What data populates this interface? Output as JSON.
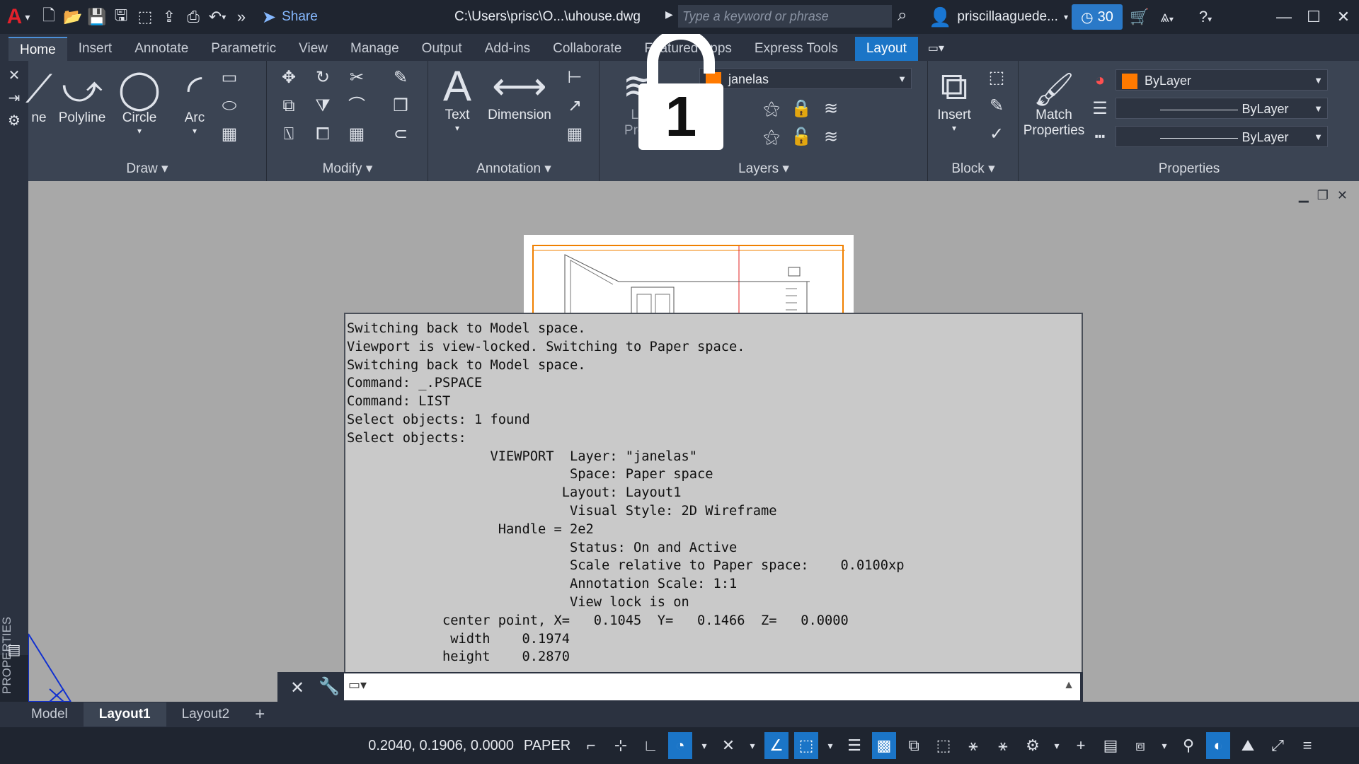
{
  "titlebar": {
    "share_label": "Share",
    "file_title": "C:\\Users\\prisc\\O...\\uhouse.dwg",
    "search_placeholder": "Type a keyword or phrase",
    "user_name": "priscillaaguede...",
    "badge_count": "30"
  },
  "ribbon_tabs": [
    "Home",
    "Insert",
    "Annotate",
    "Parametric",
    "View",
    "Manage",
    "Output",
    "Add-ins",
    "Collaborate",
    "Featured Apps",
    "Express Tools",
    "Layout"
  ],
  "ribbon": {
    "draw": {
      "title": "Draw",
      "line": "ne",
      "polyline": "Polyline",
      "circle": "Circle",
      "arc": "Arc"
    },
    "modify": {
      "title": "Modify"
    },
    "annotation": {
      "title": "Annotation",
      "text": "Text",
      "dimension": "Dimension"
    },
    "layers": {
      "title": "Layers",
      "current_layer": "janelas",
      "layer_props_1": "La",
      "layer_props_2": "Prop"
    },
    "block": {
      "title": "Block",
      "insert": "Insert"
    },
    "properties": {
      "title": "Properties",
      "match_1": "Match",
      "match_2": "Properties",
      "color": "ByLayer",
      "linetype": "ByLayer",
      "lineweight": "ByLayer"
    }
  },
  "left_palette": {
    "label": "PROPERTIES"
  },
  "lock_overlay": {
    "digit": "1"
  },
  "command_history": [
    "Switching back to Model space.",
    "Viewport is view-locked. Switching to Paper space.",
    "Switching back to Model space.",
    "Command: _.PSPACE",
    "Command: LIST",
    "Select objects: 1 found",
    "Select objects:",
    "                  VIEWPORT  Layer: \"janelas\"",
    "                            Space: Paper space",
    "                           Layout: Layout1",
    "                            Visual Style: 2D Wireframe",
    "                   Handle = 2e2",
    "                            Status: On and Active",
    "                            Scale relative to Paper space:    0.0100xp",
    "                            Annotation Scale: 1:1",
    "                            View lock is on",
    "            center point, X=   0.1045  Y=   0.1466  Z=   0.0000",
    "             width    0.1974",
    "            height    0.2870"
  ],
  "command_line": {
    "placeholder": ""
  },
  "layout_tabs": [
    "Model",
    "Layout1",
    "Layout2"
  ],
  "active_layout": "Layout1",
  "statusbar": {
    "coords": "0.2040, 0.1906, 0.0000",
    "space": "PAPER"
  },
  "colors": {
    "accent": "#1b75c7",
    "layer_color": "#ff7a00",
    "autocad_red": "#e3212b"
  }
}
